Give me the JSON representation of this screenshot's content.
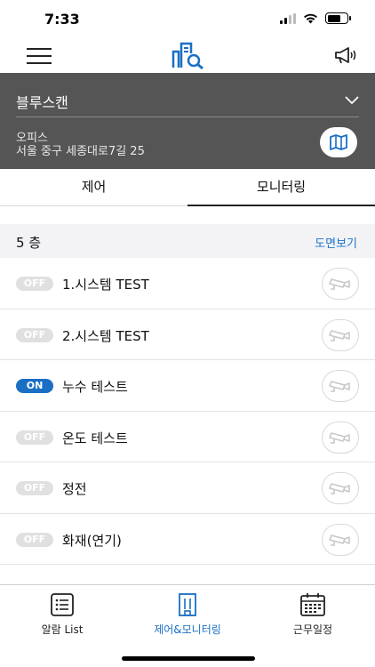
{
  "status_bar": {
    "time": "7:33"
  },
  "header": {
    "menu_icon": "hamburger-menu-icon",
    "logo_icon": "building-search-logo-icon",
    "announcement_icon": "megaphone-icon"
  },
  "location": {
    "site_name": "블루스캔",
    "site_type": "오피스",
    "address": "서울 중구 세종대로7길 25"
  },
  "tabs": [
    {
      "label": "제어",
      "active": false
    },
    {
      "label": "모니터링",
      "active": true
    }
  ],
  "floor": {
    "label": "5 층",
    "floor_plan_link": "도면보기"
  },
  "devices": [
    {
      "toggle": "OFF",
      "name": "1.시스템 TEST"
    },
    {
      "toggle": "OFF",
      "name": "2.시스템 TEST"
    },
    {
      "toggle": "ON",
      "name": "누수 테스트"
    },
    {
      "toggle": "OFF",
      "name": "온도 테스트"
    },
    {
      "toggle": "OFF",
      "name": "정전"
    },
    {
      "toggle": "OFF",
      "name": "화재(연기)"
    }
  ],
  "bottom_nav": [
    {
      "label": "알람 List",
      "icon": "list-icon",
      "active": false
    },
    {
      "label": "제어&모니터링",
      "icon": "building-icon",
      "active": true
    },
    {
      "label": "근무일정",
      "icon": "calendar-icon",
      "active": false
    }
  ],
  "colors": {
    "accent": "#1a6fc4",
    "panel": "#555555",
    "toggle_off": "#e0e0e0"
  }
}
